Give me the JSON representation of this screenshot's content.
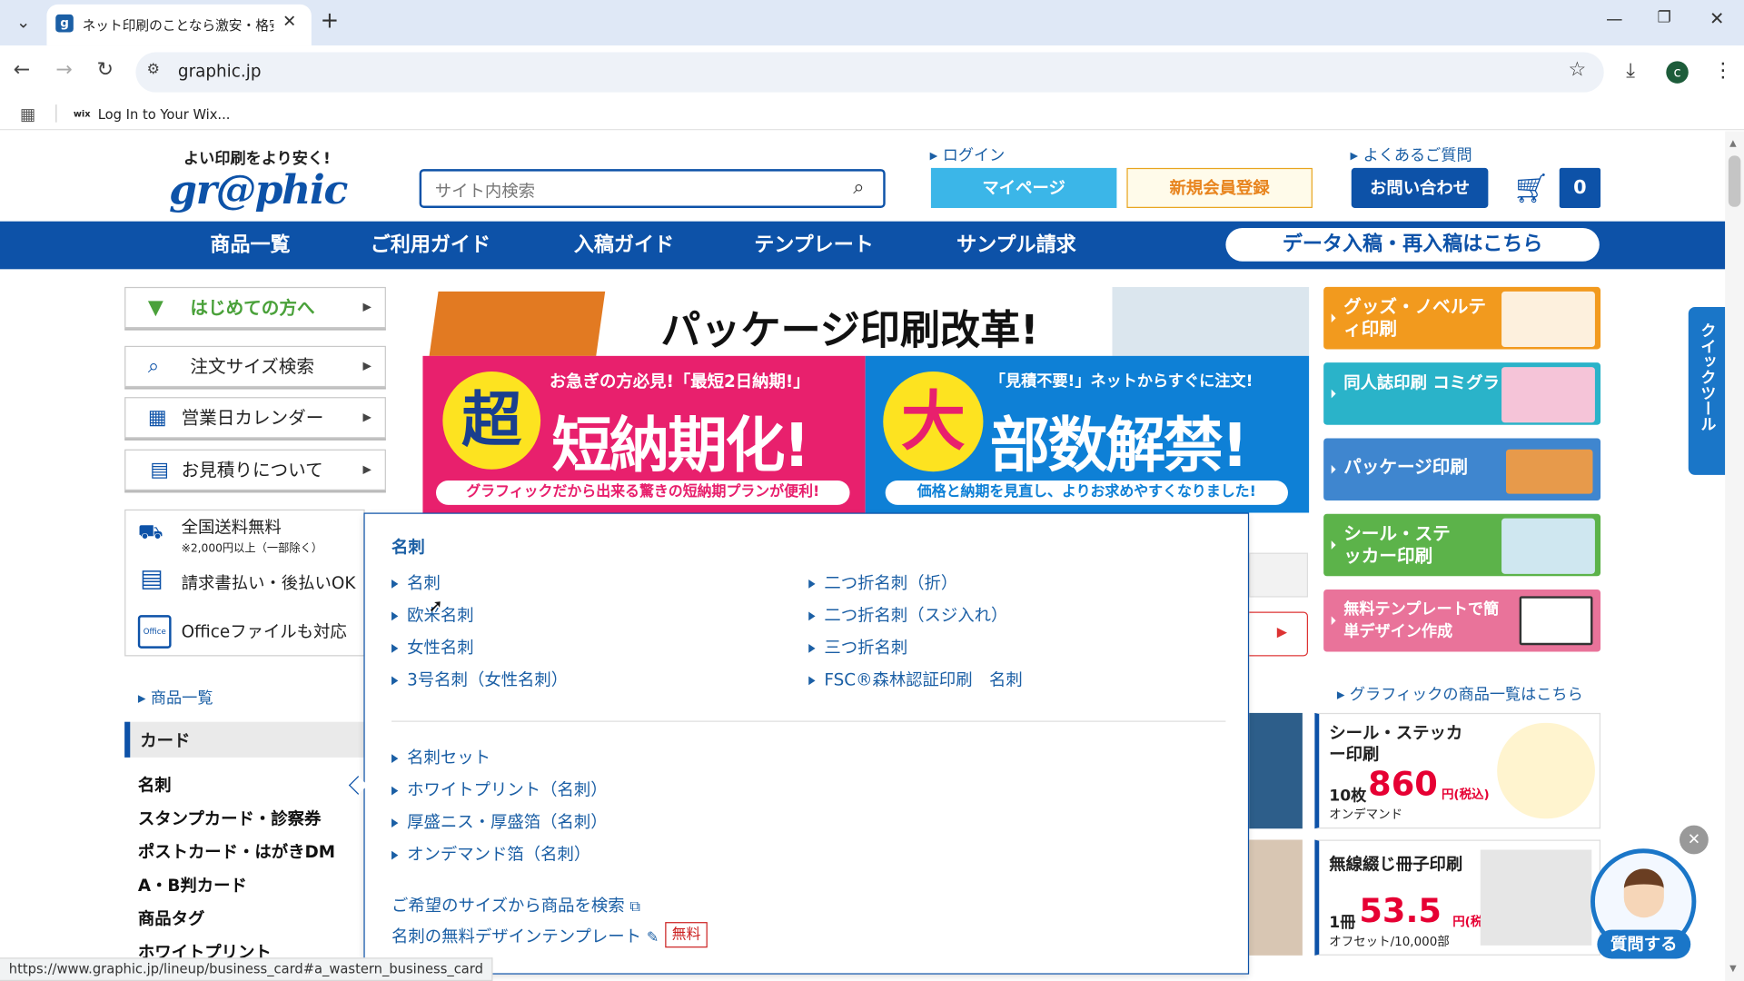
{
  "browser": {
    "tab_title": "ネット印刷のことなら激安・格安価格",
    "url": "graphic.jp",
    "bookmark": "Log In to Your Wix...",
    "bookmark_icon": "wix",
    "profile_initial": "c",
    "status_url": "https://www.graphic.jp/lineup/business_card#a_wastern_business_card"
  },
  "header": {
    "tagline": "よい印刷をより安く!",
    "logo": "gr@phic",
    "search_placeholder": "サイト内検索",
    "login": "ログイン",
    "faq": "よくあるご質問",
    "mypage": "マイページ",
    "register": "新規会員登録",
    "contact": "お問い合わせ",
    "cart_count": "0"
  },
  "nav": {
    "items": [
      "商品一覧",
      "ご利用ガイド",
      "入稿ガイド",
      "テンプレート",
      "サンプル請求"
    ],
    "data_upload": "データ入稿・再入稿はこちら"
  },
  "sidebar": {
    "buttons": [
      "はじめての方へ",
      "注文サイズ検索",
      "営業日カレンダー",
      "お見積りについて"
    ],
    "features": [
      {
        "label": "全国送料無料",
        "note": "※2,000円以上（一部除く）"
      },
      {
        "label": "請求書払い・後払いOK",
        "note": ""
      },
      {
        "label": "Officeファイルも対応",
        "note": ""
      }
    ],
    "product_list_link": "商品一覧",
    "category_header": "カード",
    "categories": [
      "名刺",
      "スタンプカード・診察券",
      "ポストカード・はがきDM",
      "A・B判カード",
      "商品タグ",
      "ホワイトプリント"
    ]
  },
  "banner": {
    "top_text": "パッケージ印刷改革!",
    "left_kicker": "お急ぎの方必見!「最短2日納期!」",
    "left_big_char": "超",
    "left_main": "短納期化!",
    "left_sub": "グラフィックだから出来る驚きの短納期プランが便利!",
    "right_kicker": "「見積不要!」ネットからすぐに注文!",
    "right_big_char": "大",
    "right_main": "部数解禁!",
    "right_sub": "価格と納期を見直し、よりお求めやすくなりました!"
  },
  "dropdown": {
    "title": "名刺",
    "col1": [
      "名刺",
      "欧米名刺",
      "女性名刺",
      "3号名刺（女性名刺）"
    ],
    "col2": [
      "二つ折名刺（折）",
      "二つ折名刺（スジ入れ）",
      "三つ折名刺",
      "FSC®森林認証印刷　名刺"
    ],
    "col3": [
      "名刺セット",
      "ホワイトプリント（名刺）",
      "厚盛ニス・厚盛箔（名刺）",
      "オンデマンド箔（名刺）"
    ],
    "search_by_size": "ご希望のサイズから商品を検索",
    "template_link": "名刺の無料デザインテンプレート",
    "free_badge": "無料"
  },
  "right_banners": [
    {
      "label": "グッズ・ノベルティ印刷",
      "color": "#f29a1e"
    },
    {
      "label": "同人誌印刷 コミグラ",
      "color": "#2ab3c9"
    },
    {
      "label": "パッケージ印刷",
      "color": "#3f86cf"
    },
    {
      "label": "シール・ステッカー印刷",
      "color": "#5cb34a"
    },
    {
      "label": "無料テンプレートで簡単デザイン作成",
      "color": "#e9739a"
    }
  ],
  "product_list_link": "グラフィックの商品一覧はこちら",
  "product_cards": [
    {
      "title": "シール・ステッカー印刷",
      "qty": "10枚",
      "price": "860",
      "unit": "円(税込)",
      "note": "オンデマンド"
    },
    {
      "title": "無線綴じ冊子印刷",
      "qty": "1冊",
      "price": "53.5",
      "unit": "円(税込)",
      "note": "オフセット/10,000部"
    }
  ],
  "quick_tool": "クイックツール",
  "chat": {
    "label": "質問する"
  },
  "colors": {
    "brand_blue": "#0d52a8",
    "mypage": "#3bb6e8",
    "price_red": "#e60033"
  }
}
